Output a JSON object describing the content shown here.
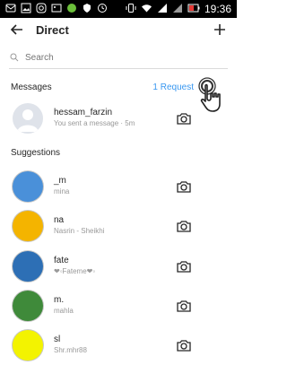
{
  "status_bar": {
    "time": "19:36"
  },
  "header": {
    "title": "Direct"
  },
  "search": {
    "placeholder": "Search"
  },
  "messages": {
    "label": "Messages",
    "request_link": "1 Request",
    "thread": {
      "name": "hessam_farzin",
      "preview": "You sent a message · 5m"
    }
  },
  "suggestions": {
    "label": "Suggestions",
    "items": [
      {
        "name": "_m",
        "sub": "mina",
        "color": "#4a90d9"
      },
      {
        "name": "na",
        "sub": "Nasrin - Sheikhi",
        "color": "#f4b400"
      },
      {
        "name": "fate",
        "sub": "❤◦Fateme❤◦",
        "color": "#2d6fb5"
      },
      {
        "name": "m.",
        "sub": "mahla",
        "color": "#3f8a3a"
      },
      {
        "name": "sl",
        "sub": "Shr.mhr88",
        "color": "#f3f300"
      }
    ]
  },
  "colors": {
    "accent": "#3897f0",
    "text": "#262626",
    "muted": "#999999"
  }
}
